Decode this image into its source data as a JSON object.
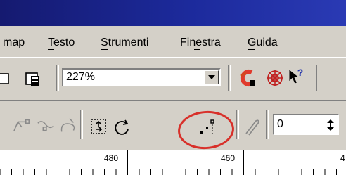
{
  "menubar": {
    "items": [
      {
        "label": "map",
        "mnemonic": ""
      },
      {
        "label": "Testo",
        "mnemonic": "T"
      },
      {
        "label": "Strumenti",
        "mnemonic": "S"
      },
      {
        "label": "Finestra",
        "mnemonic": "n"
      },
      {
        "label": "Guida",
        "mnemonic": "G"
      }
    ]
  },
  "toolbar": {
    "zoom_value": "227%",
    "icons": [
      "copy-icon",
      "paste-icon",
      "zoom-dropdown-icon",
      "color-wheel-icon",
      "web-icon",
      "whats-this-help-icon"
    ]
  },
  "property_bar": {
    "icons": [
      "convert-line-icon",
      "convert-curve-icon",
      "make-node-smooth-icon",
      "stretch-scale-nodes-icon",
      "rotate-skew-nodes-icon",
      "align-nodes-icon",
      "curve-smoothness-icon"
    ],
    "numeric_value": "0"
  },
  "ruler": {
    "labels": [
      "480",
      "460",
      "4"
    ]
  },
  "colors": {
    "title_bar": "#1c2a9c",
    "highlight_circle": "#d8302a",
    "face": "#d4d0c8"
  }
}
